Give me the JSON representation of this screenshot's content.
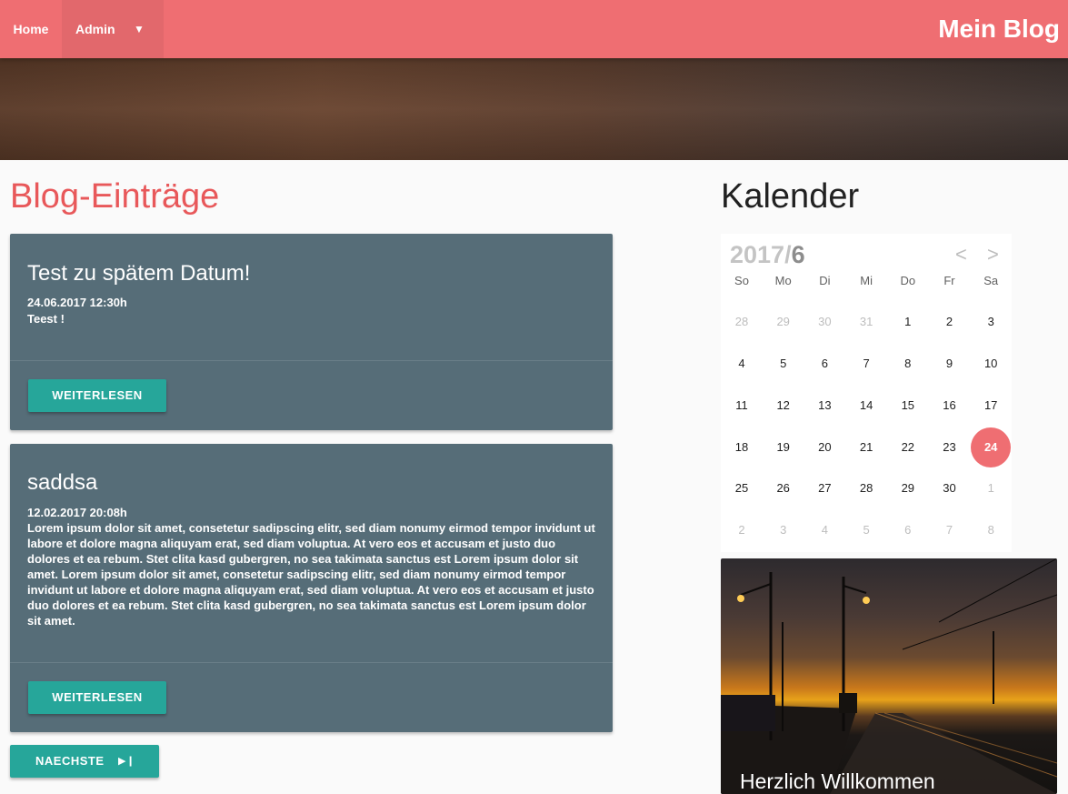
{
  "nav": {
    "home": "Home",
    "admin": "Admin",
    "brand": "Mein Blog"
  },
  "blog": {
    "title": "Blog-Einträge",
    "posts": [
      {
        "title": "Test zu spätem Datum!",
        "date": "24.06.2017 12:30h",
        "text": "Teest !",
        "button": "WEITERLESEN"
      },
      {
        "title": "saddsa",
        "date": "12.02.2017 20:08h",
        "text": "Lorem ipsum dolor sit amet, consetetur sadipscing elitr, sed diam nonumy eirmod tempor invidunt ut labore et dolore magna aliquyam erat, sed diam voluptua. At vero eos et accusam et justo duo dolores et ea rebum. Stet clita kasd gubergren, no sea takimata sanctus est Lorem ipsum dolor sit amet. Lorem ipsum dolor sit amet, consetetur sadipscing elitr, sed diam nonumy eirmod tempor invidunt ut labore et dolore magna aliquyam erat, sed diam voluptua. At vero eos et accusam et justo duo dolores et ea rebum. Stet clita kasd gubergren, no sea takimata sanctus est Lorem ipsum dolor sit amet.",
        "button": "WEITERLESEN"
      }
    ],
    "next_button": "NAECHSTE"
  },
  "calendar": {
    "title": "Kalender",
    "year": "2017/",
    "month": "6",
    "prev": "<",
    "next": ">",
    "weekdays": [
      "So",
      "Mo",
      "Di",
      "Mi",
      "Do",
      "Fr",
      "Sa"
    ],
    "weeks": [
      [
        "28",
        "29",
        "30",
        "31",
        "1",
        "2",
        "3"
      ],
      [
        "4",
        "5",
        "6",
        "7",
        "8",
        "9",
        "10"
      ],
      [
        "11",
        "12",
        "13",
        "14",
        "15",
        "16",
        "17"
      ],
      [
        "18",
        "19",
        "20",
        "21",
        "22",
        "23",
        "24"
      ],
      [
        "25",
        "26",
        "27",
        "28",
        "29",
        "30",
        "1"
      ],
      [
        "2",
        "3",
        "4",
        "5",
        "6",
        "7",
        "8"
      ]
    ],
    "today": "24"
  },
  "welcome": {
    "caption": "Herzlich Willkommen"
  },
  "colors": {
    "primary": "#ef6e72",
    "accent": "#26a69a",
    "card": "#566d78",
    "title": "#e8585a"
  }
}
